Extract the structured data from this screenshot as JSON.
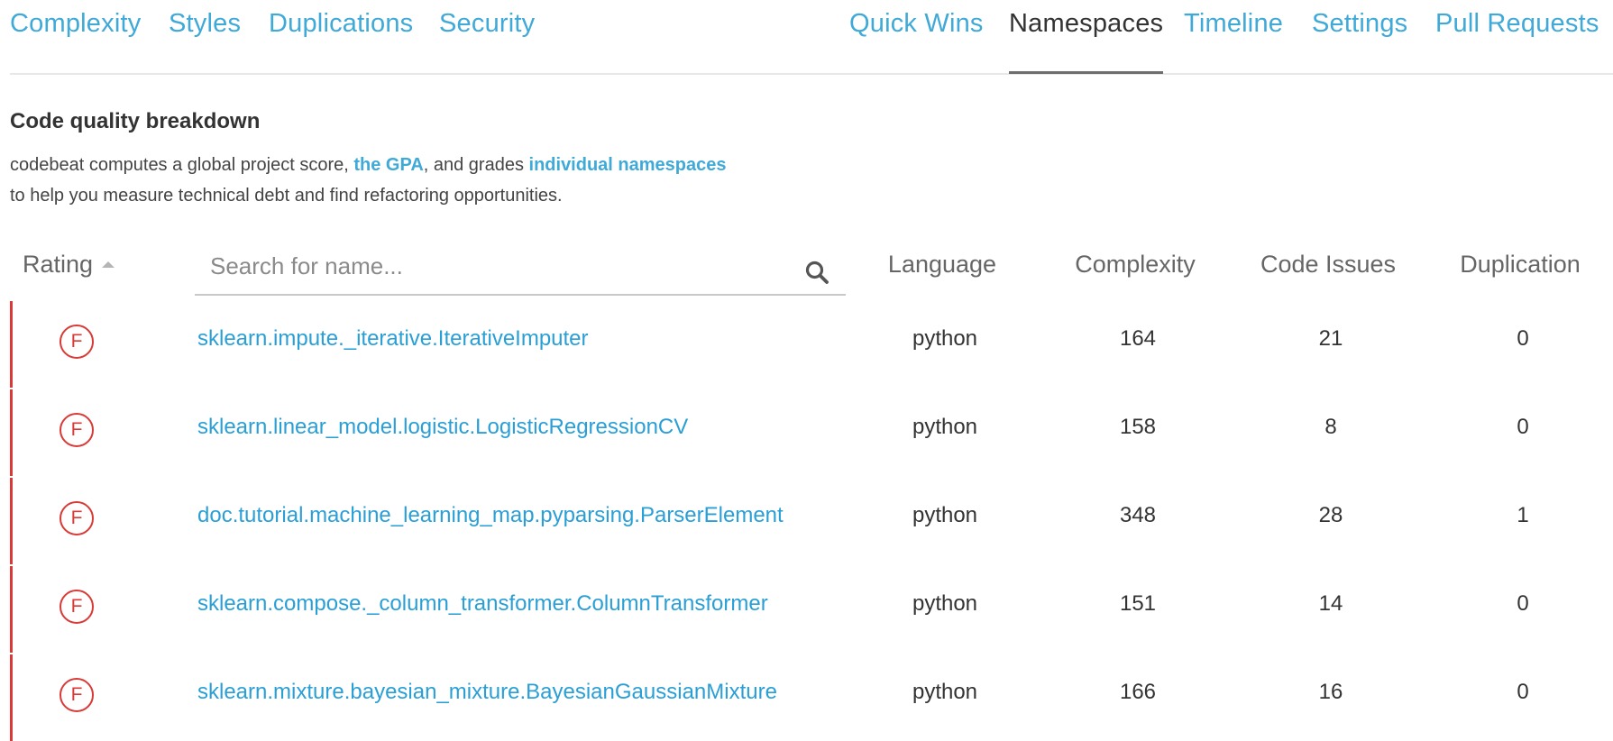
{
  "nav": {
    "left": [
      "Complexity",
      "Styles",
      "Duplications",
      "Security"
    ],
    "right": [
      "Quick Wins",
      "Namespaces",
      "Timeline",
      "Settings",
      "Pull Requests"
    ],
    "active": "Namespaces"
  },
  "intro": {
    "title": "Code quality breakdown",
    "line1_prefix": "codebeat computes a global project score, ",
    "gpa_link": "the GPA",
    "line1_middle": ", and grades ",
    "namespaces_link": "individual namespaces",
    "line2": "to help you measure technical debt and find refactoring opportunities."
  },
  "table": {
    "headers": {
      "rating": "Rating",
      "language": "Language",
      "complexity": "Complexity",
      "code_issues": "Code Issues",
      "duplication": "Duplication"
    },
    "sort": {
      "column": "Rating",
      "direction": "ascending"
    },
    "search": {
      "placeholder": "Search for name...",
      "value": "",
      "icon": "search-icon"
    },
    "rows": [
      {
        "grade": "F",
        "name": "sklearn.impute._iterative.IterativeImputer",
        "language": "python",
        "complexity": "164",
        "code_issues": "21",
        "duplication": "0"
      },
      {
        "grade": "F",
        "name": "sklearn.linear_model.logistic.LogisticRegressionCV",
        "language": "python",
        "complexity": "158",
        "code_issues": "8",
        "duplication": "0"
      },
      {
        "grade": "F",
        "name": "doc.tutorial.machine_learning_map.pyparsing.ParserElement",
        "language": "python",
        "complexity": "348",
        "code_issues": "28",
        "duplication": "1"
      },
      {
        "grade": "F",
        "name": "sklearn.compose._column_transformer.ColumnTransformer",
        "language": "python",
        "complexity": "151",
        "code_issues": "14",
        "duplication": "0"
      },
      {
        "grade": "F",
        "name": "sklearn.mixture.bayesian_mixture.BayesianGaussianMixture",
        "language": "python",
        "complexity": "166",
        "code_issues": "16",
        "duplication": "0"
      }
    ]
  },
  "colors": {
    "link": "#3fa9d8",
    "grade_f": "#d93a36",
    "text": "#333333"
  }
}
